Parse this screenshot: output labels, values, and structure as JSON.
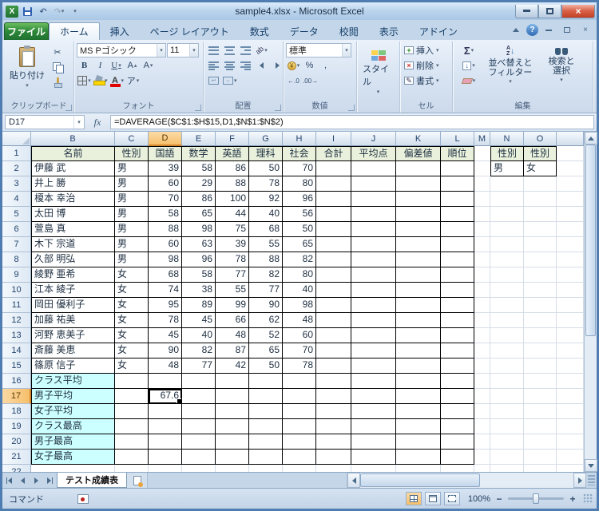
{
  "window": {
    "title": "sample4.xlsx - Microsoft Excel"
  },
  "ribbon_tabs": [
    "ファイル",
    "ホーム",
    "挿入",
    "ページ レイアウト",
    "数式",
    "データ",
    "校閲",
    "表示",
    "アドイン"
  ],
  "groups": {
    "clipboard": {
      "label": "クリップボード",
      "paste": "貼り付け"
    },
    "font": {
      "label": "フォント",
      "font_name": "MS Pゴシック",
      "font_size": "11",
      "bold": "B",
      "italic": "I",
      "underline": "U",
      "phonetic": "ア"
    },
    "align": {
      "label": "配置"
    },
    "number": {
      "label": "数値",
      "format": "標準",
      "percent": "%",
      "comma": ",",
      "inc_decimal": "←.0",
      "dec_decimal": ".00→"
    },
    "styles": {
      "label": "スタイル",
      "button": "スタイル"
    },
    "cells": {
      "label": "セル",
      "insert": "挿入",
      "delete": "削除",
      "format": "書式"
    },
    "editing": {
      "label": "編集",
      "autosum": "Σ",
      "sort_line1": "並べ替えと",
      "sort_line2": "フィルター",
      "find_line1": "検索と",
      "find_line2": "選択"
    }
  },
  "formula_bar": {
    "name_box": "D17",
    "fx": "fx",
    "formula": "=DAVERAGE($C$1:$H$15,D1,$N$1:$N$2)"
  },
  "sheet": {
    "columns": [
      "B",
      "C",
      "D",
      "E",
      "F",
      "G",
      "H",
      "I",
      "J",
      "K",
      "L",
      "M",
      "N",
      "O"
    ],
    "header_row": {
      "B": "名前",
      "C": "性別",
      "D": "国語",
      "E": "数学",
      "F": "英語",
      "G": "理科",
      "H": "社会",
      "I": "合計",
      "J": "平均点",
      "K": "偏差値",
      "L": "順位",
      "N": "性別",
      "O": "性別"
    },
    "students": [
      {
        "row": 2,
        "name": "伊藤 武",
        "gender": "男",
        "scores": [
          39,
          58,
          86,
          50,
          70
        ]
      },
      {
        "row": 3,
        "name": "井上 勝",
        "gender": "男",
        "scores": [
          60,
          29,
          88,
          78,
          80
        ]
      },
      {
        "row": 4,
        "name": "榎本 幸治",
        "gender": "男",
        "scores": [
          70,
          86,
          100,
          92,
          96
        ]
      },
      {
        "row": 5,
        "name": "太田 博",
        "gender": "男",
        "scores": [
          58,
          65,
          44,
          40,
          56
        ]
      },
      {
        "row": 6,
        "name": "萱島 真",
        "gender": "男",
        "scores": [
          88,
          98,
          75,
          68,
          50
        ]
      },
      {
        "row": 7,
        "name": "木下 宗道",
        "gender": "男",
        "scores": [
          60,
          63,
          39,
          55,
          65
        ]
      },
      {
        "row": 8,
        "name": "久部 明弘",
        "gender": "男",
        "scores": [
          98,
          96,
          78,
          88,
          82
        ]
      },
      {
        "row": 9,
        "name": "綾野 亜希",
        "gender": "女",
        "scores": [
          68,
          58,
          77,
          82,
          80
        ]
      },
      {
        "row": 10,
        "name": "江本 綾子",
        "gender": "女",
        "scores": [
          74,
          38,
          55,
          77,
          40
        ]
      },
      {
        "row": 11,
        "name": "岡田 優利子",
        "gender": "女",
        "scores": [
          95,
          89,
          99,
          90,
          98
        ]
      },
      {
        "row": 12,
        "name": "加藤 祐美",
        "gender": "女",
        "scores": [
          78,
          45,
          66,
          62,
          48
        ]
      },
      {
        "row": 13,
        "name": "河野 恵美子",
        "gender": "女",
        "scores": [
          45,
          40,
          48,
          52,
          60
        ]
      },
      {
        "row": 14,
        "name": "斎藤 美恵",
        "gender": "女",
        "scores": [
          90,
          82,
          87,
          65,
          70
        ]
      },
      {
        "row": 15,
        "name": "篠原 信子",
        "gender": "女",
        "scores": [
          48,
          77,
          42,
          50,
          78
        ]
      }
    ],
    "criteria_row": {
      "N": "男",
      "O": "女"
    },
    "summary_rows": [
      {
        "row": 16,
        "label": "クラス平均"
      },
      {
        "row": 17,
        "label": "男子平均",
        "d_value": "67.6"
      },
      {
        "row": 18,
        "label": "女子平均"
      },
      {
        "row": 19,
        "label": "クラス最高"
      },
      {
        "row": 20,
        "label": "男子最高"
      },
      {
        "row": 21,
        "label": "女子最高"
      }
    ],
    "selection": {
      "cell": "D17",
      "column": "D",
      "row": 17
    }
  },
  "sheet_tabs": {
    "active_tab": "テスト成績表"
  },
  "status_bar": {
    "mode": "コマンド",
    "zoom": "100%"
  },
  "icons": {
    "undo": "↶",
    "redo": "↷",
    "help": "?",
    "close": "×",
    "scissors": "✂",
    "sort_arrow": "↓",
    "zoom_out": "−",
    "zoom_in": "+"
  }
}
